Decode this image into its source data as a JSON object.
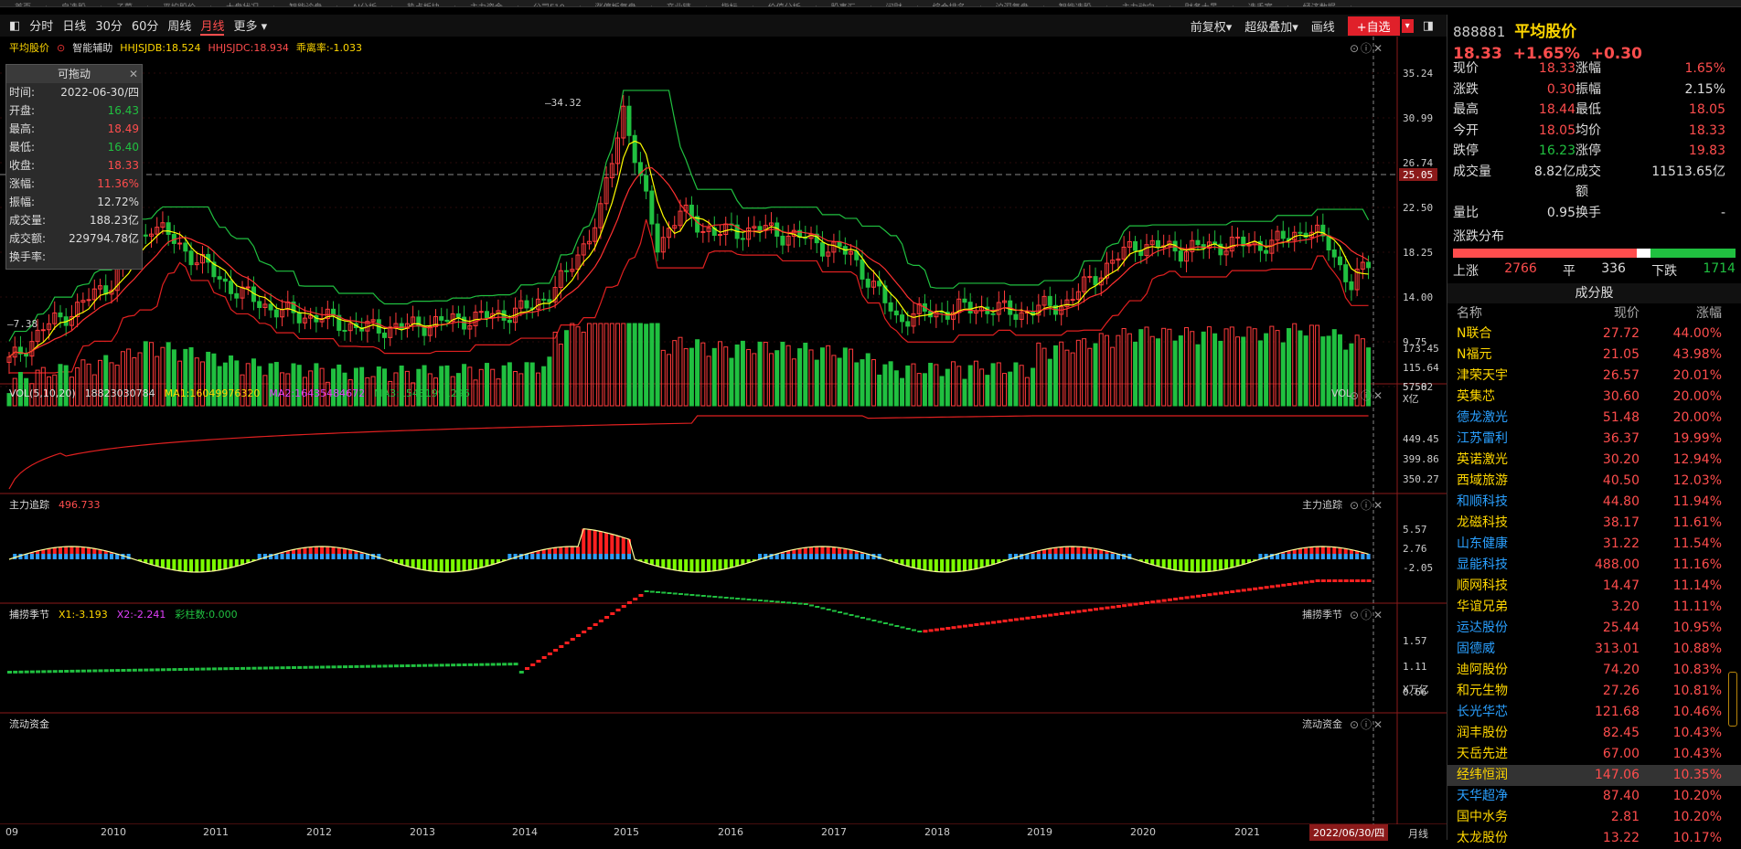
{
  "toolbar": {
    "tabs": [
      "分时",
      "日线",
      "30分",
      "60分",
      "周线",
      "月线",
      "更多 ▾"
    ],
    "active": 5,
    "right": [
      "前复权▾",
      "超级叠加▾",
      "画线"
    ],
    "add": "+自选"
  },
  "main": {
    "name": "平均股价",
    "assist": "智能辅助",
    "hh": "HHJSJDB:18.524",
    "ll": "HHJSJDC:18.934",
    "dev": "乖离率:-1.033",
    "yticks": [
      "35.24",
      "30.99",
      "26.74",
      "22.50",
      "18.25",
      "14.00",
      "9.75",
      "5.50"
    ],
    "hi": "34.32",
    "lo": "7.38",
    "cur": "25.05"
  },
  "float": {
    "title": "可拖动",
    "rows": [
      [
        "时间:",
        "2022-06-30/四",
        "w"
      ],
      [
        "开盘:",
        "16.43",
        "g"
      ],
      [
        "最高:",
        "18.49",
        "r"
      ],
      [
        "最低:",
        "16.40",
        "g"
      ],
      [
        "收盘:",
        "18.33",
        "r"
      ],
      [
        "涨幅:",
        "11.36%",
        "r"
      ],
      [
        "振幅:",
        "12.72%",
        "w"
      ],
      [
        "成交量:",
        "188.23亿",
        "w"
      ],
      [
        "成交额:",
        "229794.78亿",
        "w"
      ],
      [
        "换手率:",
        "",
        "w"
      ]
    ]
  },
  "vol": {
    "label": "VOL(5,10,20)",
    "val": "18823030784",
    "ma1": "MA1:16049976320",
    "ma2": "MA2:16435484672",
    "ma3": "MA3:15431991296",
    "right": "VOL",
    "yticks": [
      "173.45",
      "115.64",
      "57.82"
    ],
    "unit": "X亿"
  },
  "zl": {
    "label": "主力追踪",
    "val": "496.733",
    "right": "主力追踪",
    "yticks": [
      "449.45",
      "399.86",
      "350.27"
    ]
  },
  "bz": {
    "label": "捕捞季节",
    "x1": "X1:-3.193",
    "x2": "X2:-2.241",
    "cz": "彩柱数:0.000",
    "right": "捕捞季节",
    "yticks": [
      "5.57",
      "2.76",
      "-2.05"
    ]
  },
  "ld": {
    "label": "流动资金",
    "right": "流动资金",
    "yticks": [
      "1.57",
      "1.11",
      "0.66"
    ],
    "unit": "X万亿"
  },
  "xaxis": {
    "labels": [
      "09",
      "2010",
      "2011",
      "2012",
      "2013",
      "2014",
      "2015",
      "2016",
      "2017",
      "2018",
      "2019",
      "2020",
      "2021"
    ],
    "cur": "2022/06/30/四",
    "period": "月线"
  },
  "quote": {
    "code": "888881",
    "name": "平均股价",
    "price": "18.33",
    "pct": "+1.65%",
    "chg": "+0.30",
    "grid": [
      [
        "现价",
        "18.33",
        "r",
        "涨幅",
        "1.65%",
        "r"
      ],
      [
        "涨跌",
        "0.30",
        "r",
        "振幅",
        "2.15%",
        "w"
      ],
      [
        "最高",
        "18.44",
        "r",
        "最低",
        "18.05",
        "r"
      ],
      [
        "今开",
        "18.05",
        "r",
        "均价",
        "18.33",
        "r"
      ],
      [
        "跌停",
        "16.23",
        "g",
        "涨停",
        "19.83",
        "r"
      ],
      [
        "成交量",
        "8.82亿",
        "w",
        "成交额",
        "11513.65亿",
        "w"
      ],
      [
        "量比",
        "0.95",
        "w",
        "换手",
        "-",
        "w"
      ]
    ],
    "dist": "涨跌分布",
    "up": "上涨",
    "upn": "2766",
    "flat": "平",
    "flatn": "336",
    "down": "下跌",
    "downn": "1714"
  },
  "comp": {
    "title": "成分股",
    "head": [
      "名称",
      "现价",
      "涨幅"
    ],
    "rows": [
      [
        "N联合",
        "27.72",
        "44.00%",
        "y"
      ],
      [
        "N福元",
        "21.05",
        "43.98%",
        "y"
      ],
      [
        "津荣天宇",
        "26.57",
        "20.01%",
        "y"
      ],
      [
        "英集芯",
        "30.60",
        "20.00%",
        "y"
      ],
      [
        "德龙激光",
        "51.48",
        "20.00%",
        "c"
      ],
      [
        "江苏雷利",
        "36.37",
        "19.99%",
        "c"
      ],
      [
        "英诺激光",
        "30.20",
        "12.94%",
        "y"
      ],
      [
        "西域旅游",
        "40.50",
        "12.03%",
        "y"
      ],
      [
        "和顺科技",
        "44.80",
        "11.94%",
        "c"
      ],
      [
        "龙磁科技",
        "38.17",
        "11.61%",
        "y"
      ],
      [
        "山东健康",
        "31.22",
        "11.54%",
        "c"
      ],
      [
        "显能科技",
        "488.00",
        "11.16%",
        "c"
      ],
      [
        "顺网科技",
        "14.47",
        "11.14%",
        "y"
      ],
      [
        "华谊兄弟",
        "3.20",
        "11.11%",
        "y"
      ],
      [
        "运达股份",
        "25.44",
        "10.95%",
        "c"
      ],
      [
        "固德威",
        "313.01",
        "10.88%",
        "c"
      ],
      [
        "迪阿股份",
        "74.20",
        "10.83%",
        "y"
      ],
      [
        "和元生物",
        "27.26",
        "10.81%",
        "y"
      ],
      [
        "长光华芯",
        "121.68",
        "10.46%",
        "c"
      ],
      [
        "润丰股份",
        "82.45",
        "10.43%",
        "y"
      ],
      [
        "天岳先进",
        "67.00",
        "10.43%",
        "y"
      ],
      [
        "经纬恒润",
        "147.06",
        "10.35%",
        "y"
      ],
      [
        "天华超净",
        "87.40",
        "10.20%",
        "c"
      ],
      [
        "国中水务",
        "2.81",
        "10.20%",
        "y"
      ],
      [
        "太龙股份",
        "13.22",
        "10.17%",
        "y"
      ]
    ]
  }
}
